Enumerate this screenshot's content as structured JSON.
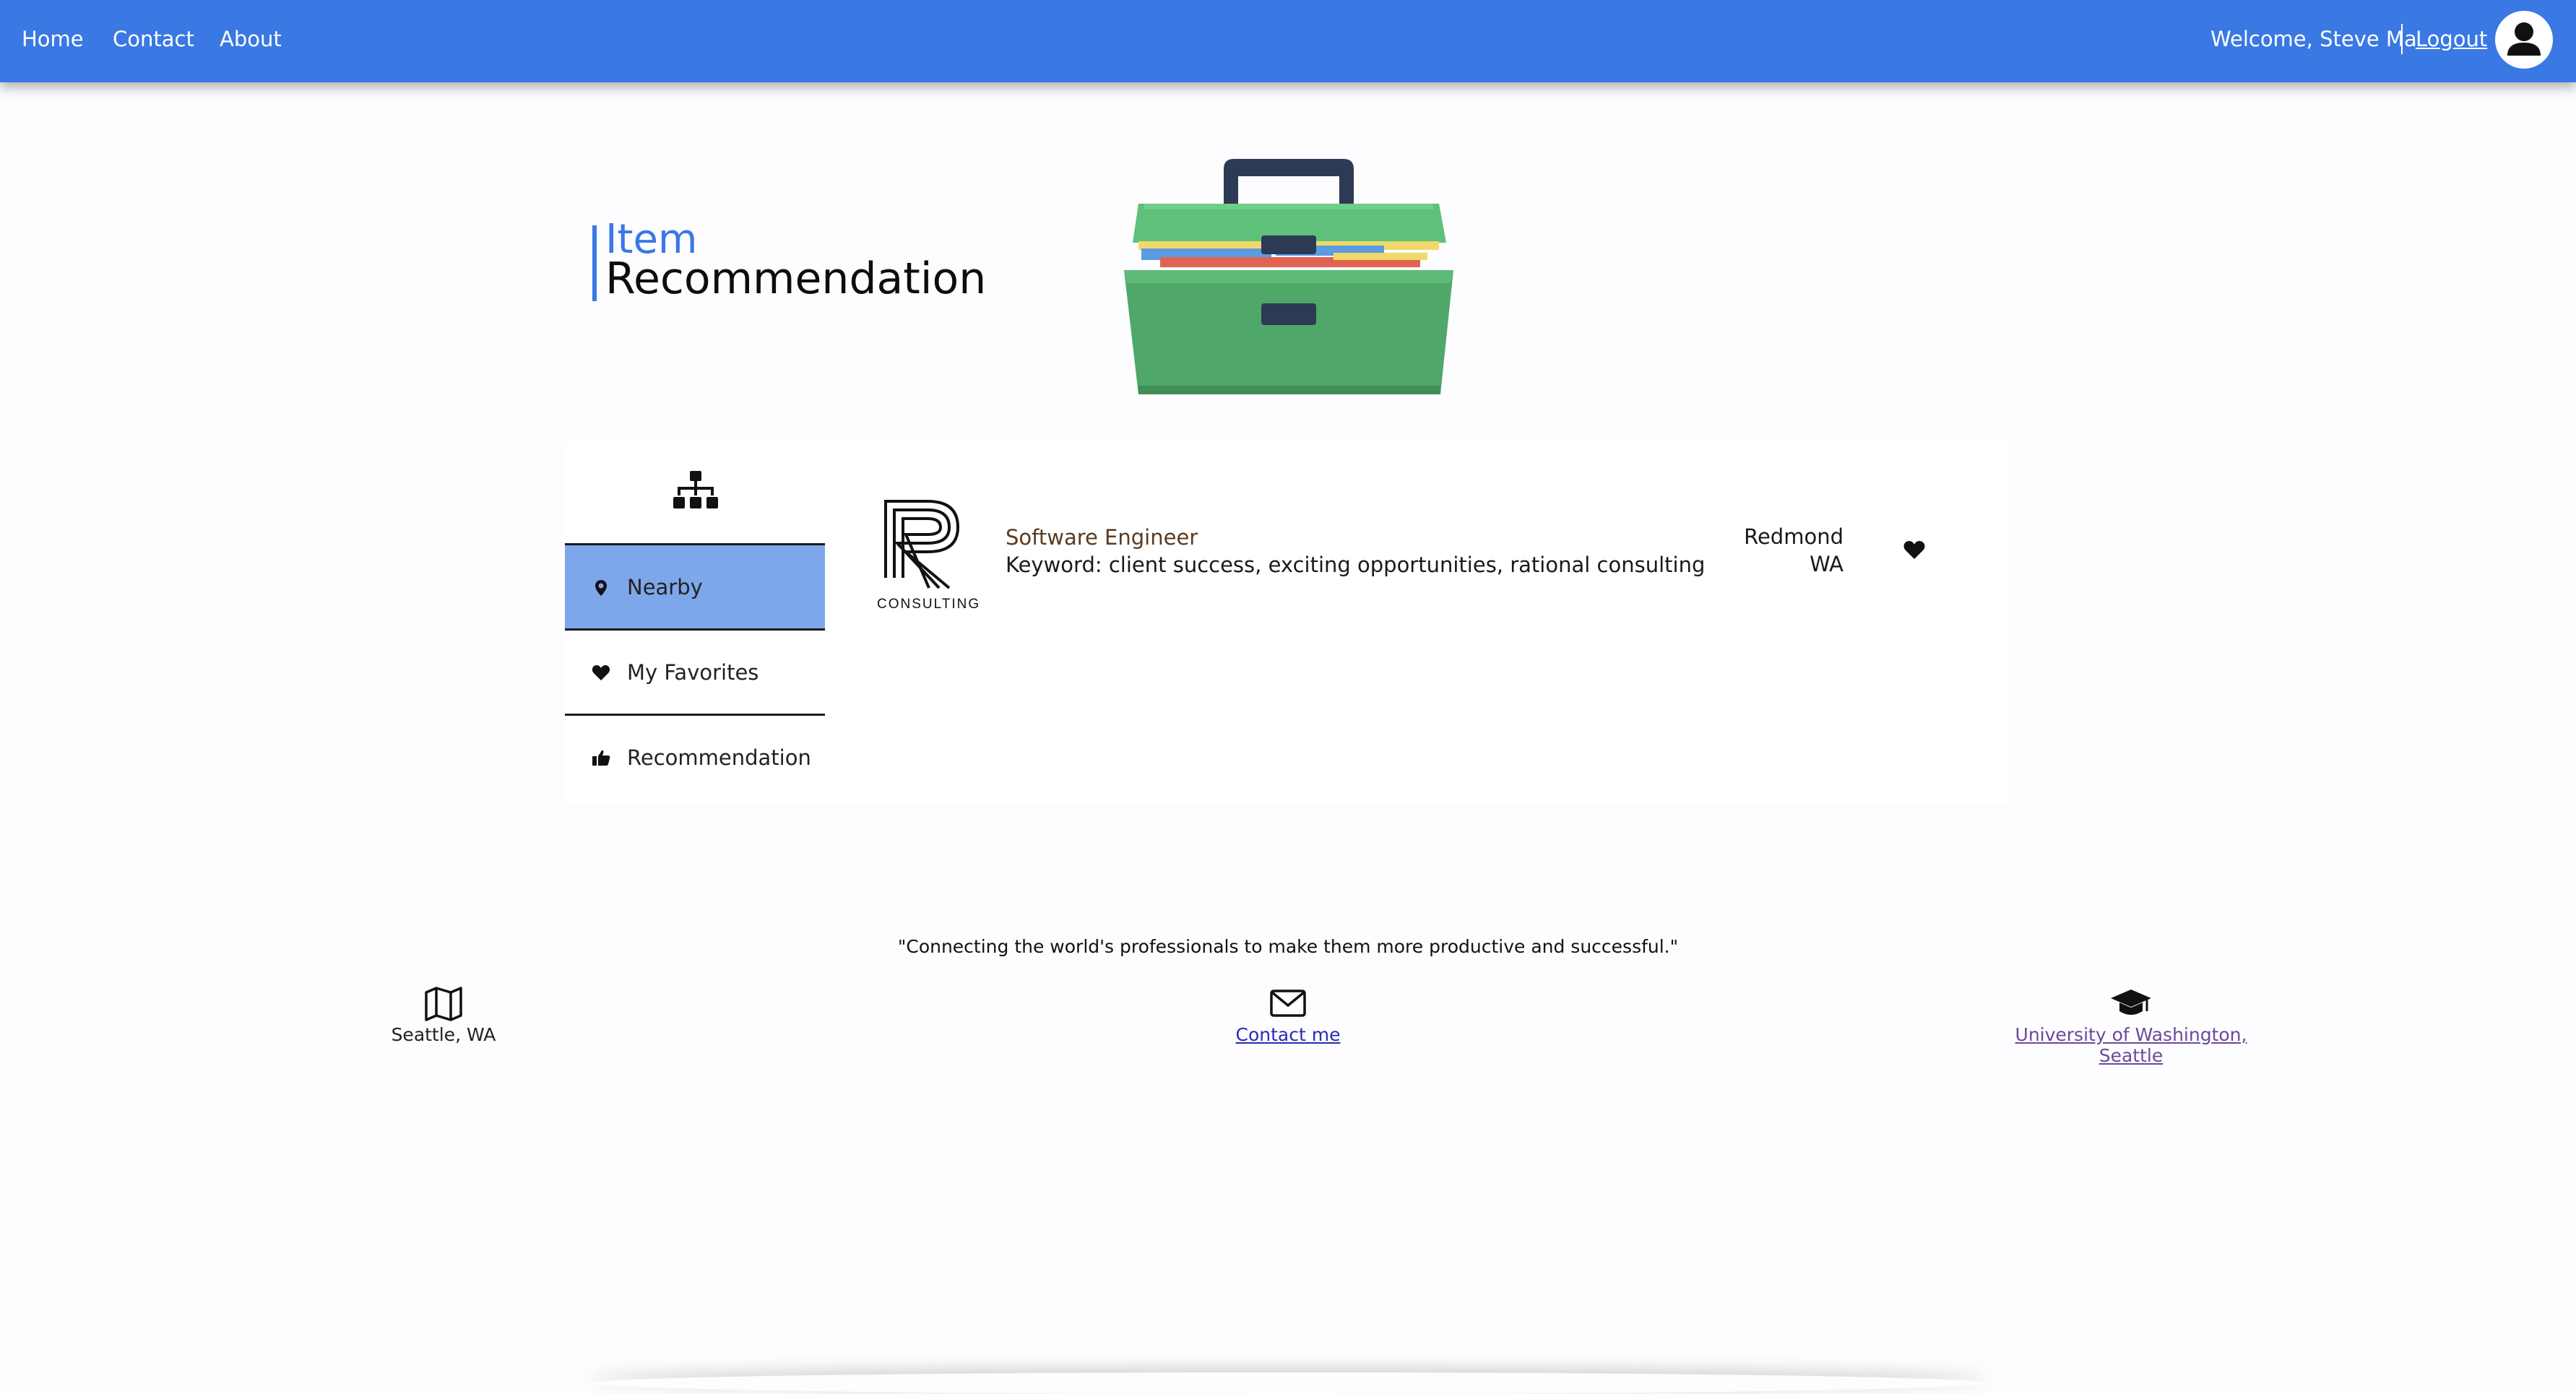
{
  "nav": {
    "links": [
      "Home",
      "Contact",
      "About"
    ],
    "welcome": "Welcome, Steve Ma",
    "logout": "Logout"
  },
  "header": {
    "title_line1": "Item",
    "title_line2": "Recommendation"
  },
  "sidebar": {
    "items": [
      {
        "label": "Nearby",
        "icon": "map-marker-icon",
        "active": true
      },
      {
        "label": "My Favorites",
        "icon": "heart-icon",
        "active": false
      },
      {
        "label": "Recommendation",
        "icon": "thumbs-up-icon",
        "active": false
      }
    ]
  },
  "jobs": [
    {
      "logo_text": "CONSULTING",
      "title": "Software Engineer",
      "keywords": "Keyword: client success, exciting opportunities, rational consulting",
      "city": "Redmond",
      "state": "WA",
      "favorited": true
    }
  ],
  "footer": {
    "quote": "\"Connecting the world's professionals to make them more productive and successful.\"",
    "location": "Seattle, WA",
    "contact": "Contact me",
    "school": "University of Washington, Seattle"
  },
  "colors": {
    "brand_blue": "#3a78e4",
    "active_nav": "#7ea6ea"
  }
}
